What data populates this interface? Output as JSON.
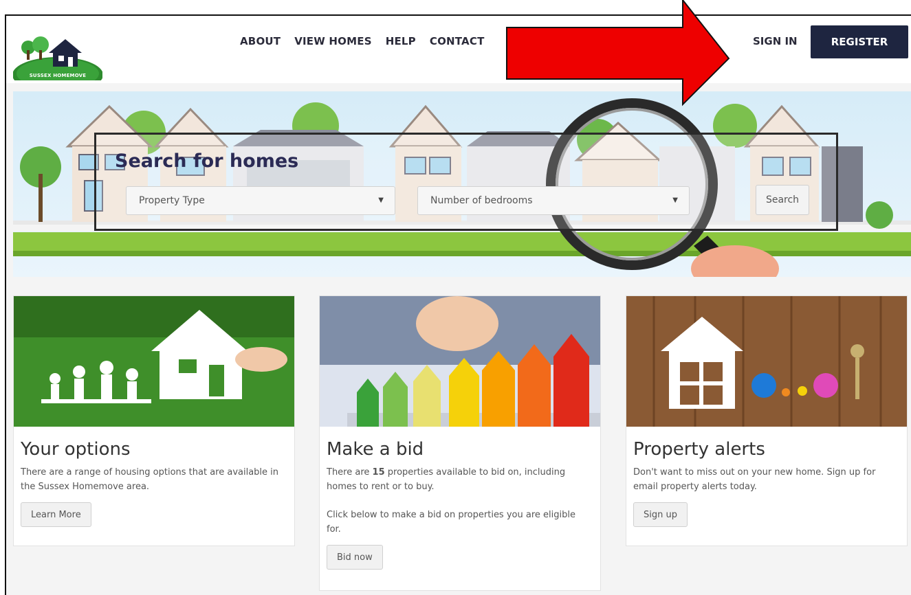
{
  "header": {
    "logo_text": "SUSSEX HOMEMOVE",
    "nav": [
      "ABOUT",
      "VIEW HOMES",
      "HELP",
      "CONTACT"
    ],
    "sign_in": "SIGN IN",
    "register": "REGISTER"
  },
  "search": {
    "title": "Search for homes",
    "property_type": "Property Type",
    "bedrooms": "Number of bedrooms",
    "button": "Search"
  },
  "cards": [
    {
      "title": "Your options",
      "text": "There are a range of housing options that are available in the Sussex Homemove area.",
      "button": "Learn More"
    },
    {
      "title": "Make a bid",
      "text_before": "There are ",
      "count": "15",
      "text_after": " properties available to bid on, including homes to rent or to buy.",
      "text2": "Click below to make a bid on properties you are eligible for.",
      "button": "Bid now"
    },
    {
      "title": "Property alerts",
      "text": "Don't want to miss out on your new home. Sign up for email property alerts today.",
      "button": "Sign up"
    }
  ],
  "colors": {
    "accent": "#1e2540",
    "arrow": "#ee0000"
  }
}
